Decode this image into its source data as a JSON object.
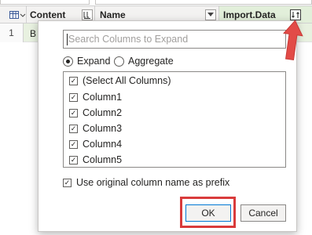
{
  "table": {
    "columns": [
      {
        "label": "Content"
      },
      {
        "label": "Name"
      },
      {
        "label": "Import.Data"
      }
    ],
    "rows": [
      {
        "index": "1",
        "content": "B"
      }
    ]
  },
  "dialog": {
    "search_placeholder": "Search Columns to Expand",
    "mode_options": [
      {
        "label": "Expand",
        "selected": true
      },
      {
        "label": "Aggregate",
        "selected": false
      }
    ],
    "columns": [
      {
        "label": "(Select All Columns)",
        "checked": true
      },
      {
        "label": "Column1",
        "checked": true
      },
      {
        "label": "Column2",
        "checked": true
      },
      {
        "label": "Column3",
        "checked": true
      },
      {
        "label": "Column4",
        "checked": true
      },
      {
        "label": "Column5",
        "checked": true
      }
    ],
    "prefix_option": {
      "label": "Use original column name as prefix",
      "checked": true
    },
    "ok_label": "OK",
    "cancel_label": "Cancel"
  },
  "icons": {
    "table_menu": "table-icon",
    "expand": "expand-columns-icon",
    "arrow": "red-arrow-annotation"
  },
  "colors": {
    "accent": "#0078d4",
    "highlight": "#d93b3b",
    "import_header": "#e2efda"
  }
}
